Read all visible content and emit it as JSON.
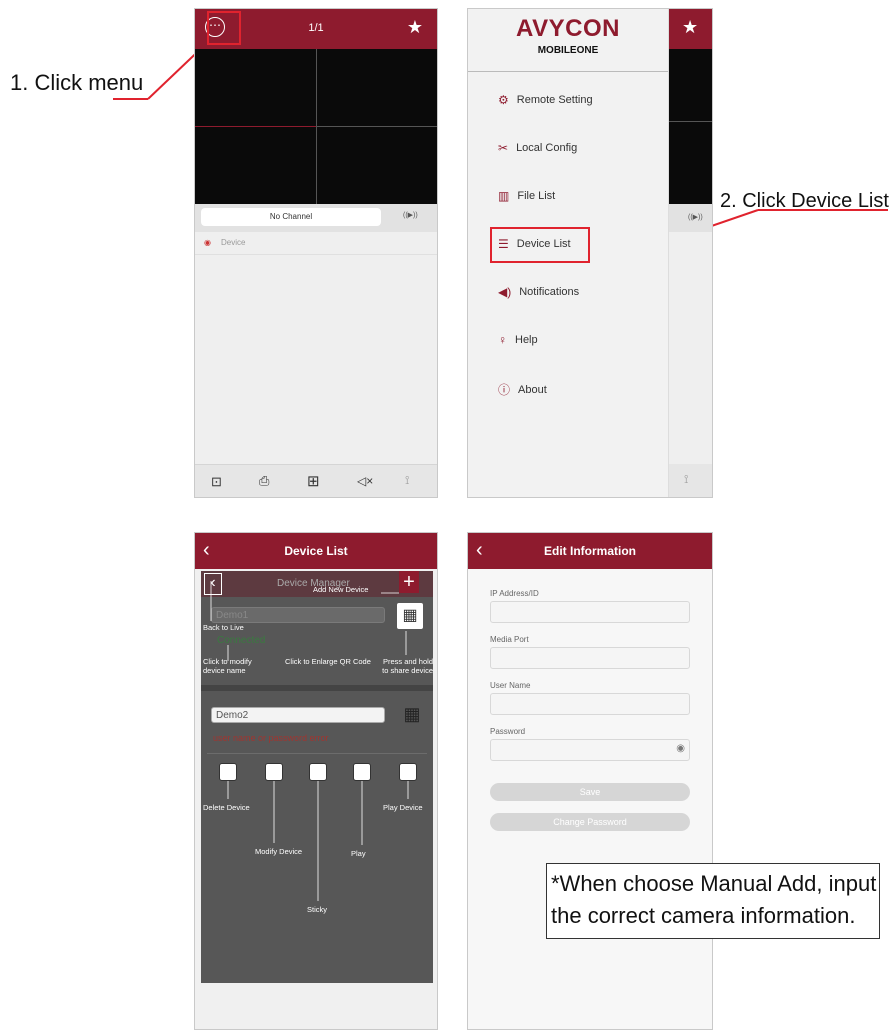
{
  "annotations": {
    "step1": "1. Click menu",
    "step2": "2. Click Device List",
    "note_line1": "*When choose Manual Add, input",
    "note_line2": "the correct camera information."
  },
  "live": {
    "page_indicator": "1/1",
    "channel_label": "No Channel",
    "device_label": "Device"
  },
  "drawer": {
    "brand": "AVYCON",
    "brand_sub": "MOBILEONE",
    "items": [
      {
        "label": "Remote Setting",
        "icon": "remote-setting-icon"
      },
      {
        "label": "Local Config",
        "icon": "tools-icon"
      },
      {
        "label": "File List",
        "icon": "file-list-icon"
      },
      {
        "label": "Device List",
        "icon": "device-list-icon"
      },
      {
        "label": "Notifications",
        "icon": "megaphone-icon"
      },
      {
        "label": "Help",
        "icon": "bulb-icon"
      },
      {
        "label": "About",
        "icon": "info-icon"
      }
    ]
  },
  "device_list": {
    "title": "Device List",
    "inner_title": "Device Manager",
    "devices": [
      {
        "name": "Demo1",
        "status": "Connected"
      },
      {
        "name": "Demo2",
        "status": "user name or password error"
      }
    ],
    "callouts": {
      "add_new": "Add New Device",
      "back": "Back to Live",
      "modify_name": "Click to modify device name",
      "enlarge_qr": "Click to Enlarge QR Code",
      "share": "Press and hold to share device",
      "delete": "Delete Device",
      "modify": "Modify Device",
      "play": "Play",
      "play_device": "Play Device",
      "sticky": "Sticky"
    }
  },
  "edit_info": {
    "title": "Edit Information",
    "fields": [
      "IP Address/ID",
      "Media Port",
      "User Name",
      "Password"
    ],
    "save": "Save",
    "change_password": "Change Password"
  },
  "colors": {
    "brand": "#8e1b2e",
    "annotation": "#e0232e",
    "connected": "#3a9a45",
    "error": "#b0312b"
  }
}
